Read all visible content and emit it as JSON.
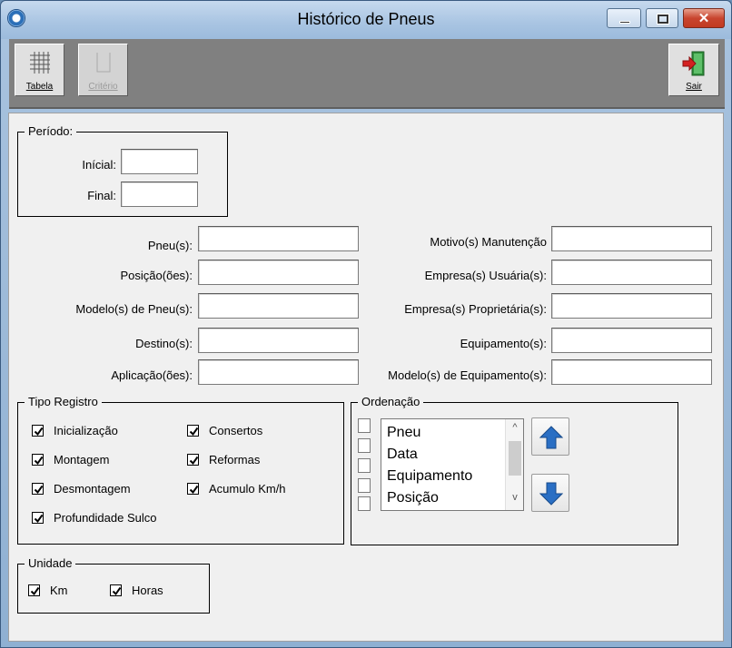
{
  "window": {
    "title": "Histórico de Pneus",
    "minimize_glyph": "—",
    "close_glyph": "✕"
  },
  "toolbar": {
    "tabela_label": "Tabela",
    "criterio_label": "Critério",
    "sair_label": "Sair"
  },
  "periodo": {
    "legend": "Período:",
    "inicial_label": "Inícial:",
    "inicial_value": "",
    "final_label": "Final:",
    "final_value": ""
  },
  "filters_left": [
    {
      "label": "Pneu(s):",
      "value": ""
    },
    {
      "label": "Posição(ões):",
      "value": ""
    },
    {
      "label": "Modelo(s) de Pneu(s):",
      "value": ""
    },
    {
      "label": "Destino(s):",
      "value": ""
    },
    {
      "label": "Aplicação(ões):",
      "value": ""
    }
  ],
  "filters_right": [
    {
      "label": "Motivo(s) Manutenção",
      "value": ""
    },
    {
      "label": "Empresa(s) Usuária(s):",
      "value": ""
    },
    {
      "label": "Empresa(s) Proprietária(s):",
      "value": ""
    },
    {
      "label": "Equipamento(s):",
      "value": ""
    },
    {
      "label": "Modelo(s) de Equipamento(s):",
      "value": ""
    }
  ],
  "tipo_registro": {
    "legend": "Tipo Registro",
    "items": [
      {
        "label": "Inicialização",
        "checked": true
      },
      {
        "label": "Montagem",
        "checked": true
      },
      {
        "label": "Desmontagem",
        "checked": true
      },
      {
        "label": "Profundidade Sulco",
        "checked": true
      },
      {
        "label": "Consertos",
        "checked": true
      },
      {
        "label": "Reformas",
        "checked": true
      },
      {
        "label": "Acumulo Km/h",
        "checked": true
      }
    ]
  },
  "ordenacao": {
    "legend": "Ordenação",
    "items": [
      "Pneu",
      "Data",
      "Equipamento",
      "Posição"
    ],
    "scroll_up": "^",
    "scroll_down": "v"
  },
  "unidade": {
    "legend": "Unidade",
    "items": [
      {
        "label": "Km",
        "checked": true
      },
      {
        "label": "Horas",
        "checked": true
      }
    ]
  },
  "colors": {
    "arrow_blue": "#2a6fc4",
    "exit_red": "#d42020",
    "exit_green": "#2f8f3a"
  }
}
